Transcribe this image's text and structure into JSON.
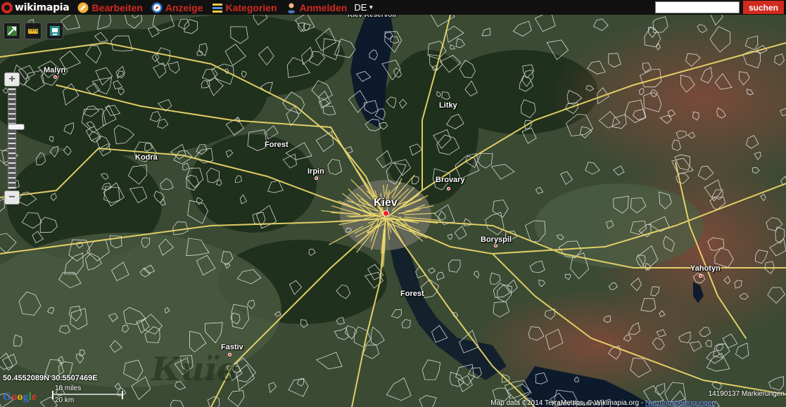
{
  "app": {
    "logo_text": "wikimapia"
  },
  "menu": [
    {
      "label": "Bearbeiten",
      "icon": "edit-icon",
      "color": "#f0a020"
    },
    {
      "label": "Anzeige",
      "icon": "compass-icon",
      "color": "#2f7ad0"
    },
    {
      "label": "Kategorien",
      "icon": "categories-icon",
      "color": "#e0a020"
    },
    {
      "label": "Anmelden",
      "icon": "user-icon",
      "color": "#e08a50"
    }
  ],
  "language": {
    "value": "DE"
  },
  "search": {
    "placeholder": "",
    "value": "",
    "button_label": "suchen"
  },
  "colors": {
    "brand": "#d12a1f",
    "roads": "#f2dc6e",
    "outlines": "#ffffff",
    "water": "#0c1a2c"
  },
  "places": [
    {
      "name": "Malyn",
      "kind": "town"
    },
    {
      "name": "Kodra",
      "kind": "village"
    },
    {
      "name": "Forest",
      "kind": "forest"
    },
    {
      "name": "Irpin",
      "kind": "town"
    },
    {
      "name": "Kiev",
      "kind": "city"
    },
    {
      "name": "Litky",
      "kind": "village"
    },
    {
      "name": "Brovary",
      "kind": "town"
    },
    {
      "name": "Boryspil",
      "kind": "town"
    },
    {
      "name": "Forest",
      "kind": "forest"
    },
    {
      "name": "Yahotyn",
      "kind": "town"
    },
    {
      "name": "Fastiv",
      "kind": "town"
    },
    {
      "name": "Kiev Reservoir",
      "kind": "water"
    },
    {
      "name": "Kaniv Reservoir",
      "kind": "water"
    }
  ],
  "zoom": {
    "level_fraction": 0.63
  },
  "coordinates": {
    "text": "50.4552089N 30.5507469E"
  },
  "scale": {
    "top_label": "10 miles",
    "bottom_label": "20 km"
  },
  "map_footer": {
    "google": [
      "G",
      "o",
      "o",
      "g",
      "l",
      "e"
    ],
    "marker_count": "14190137 Markierungen",
    "attribution": "Map data ©2014 TerraMetrics, © Wikimapia.org",
    "terms_link": "Nutzungsbedingungen"
  },
  "watermark": {
    "text": "Київ"
  }
}
